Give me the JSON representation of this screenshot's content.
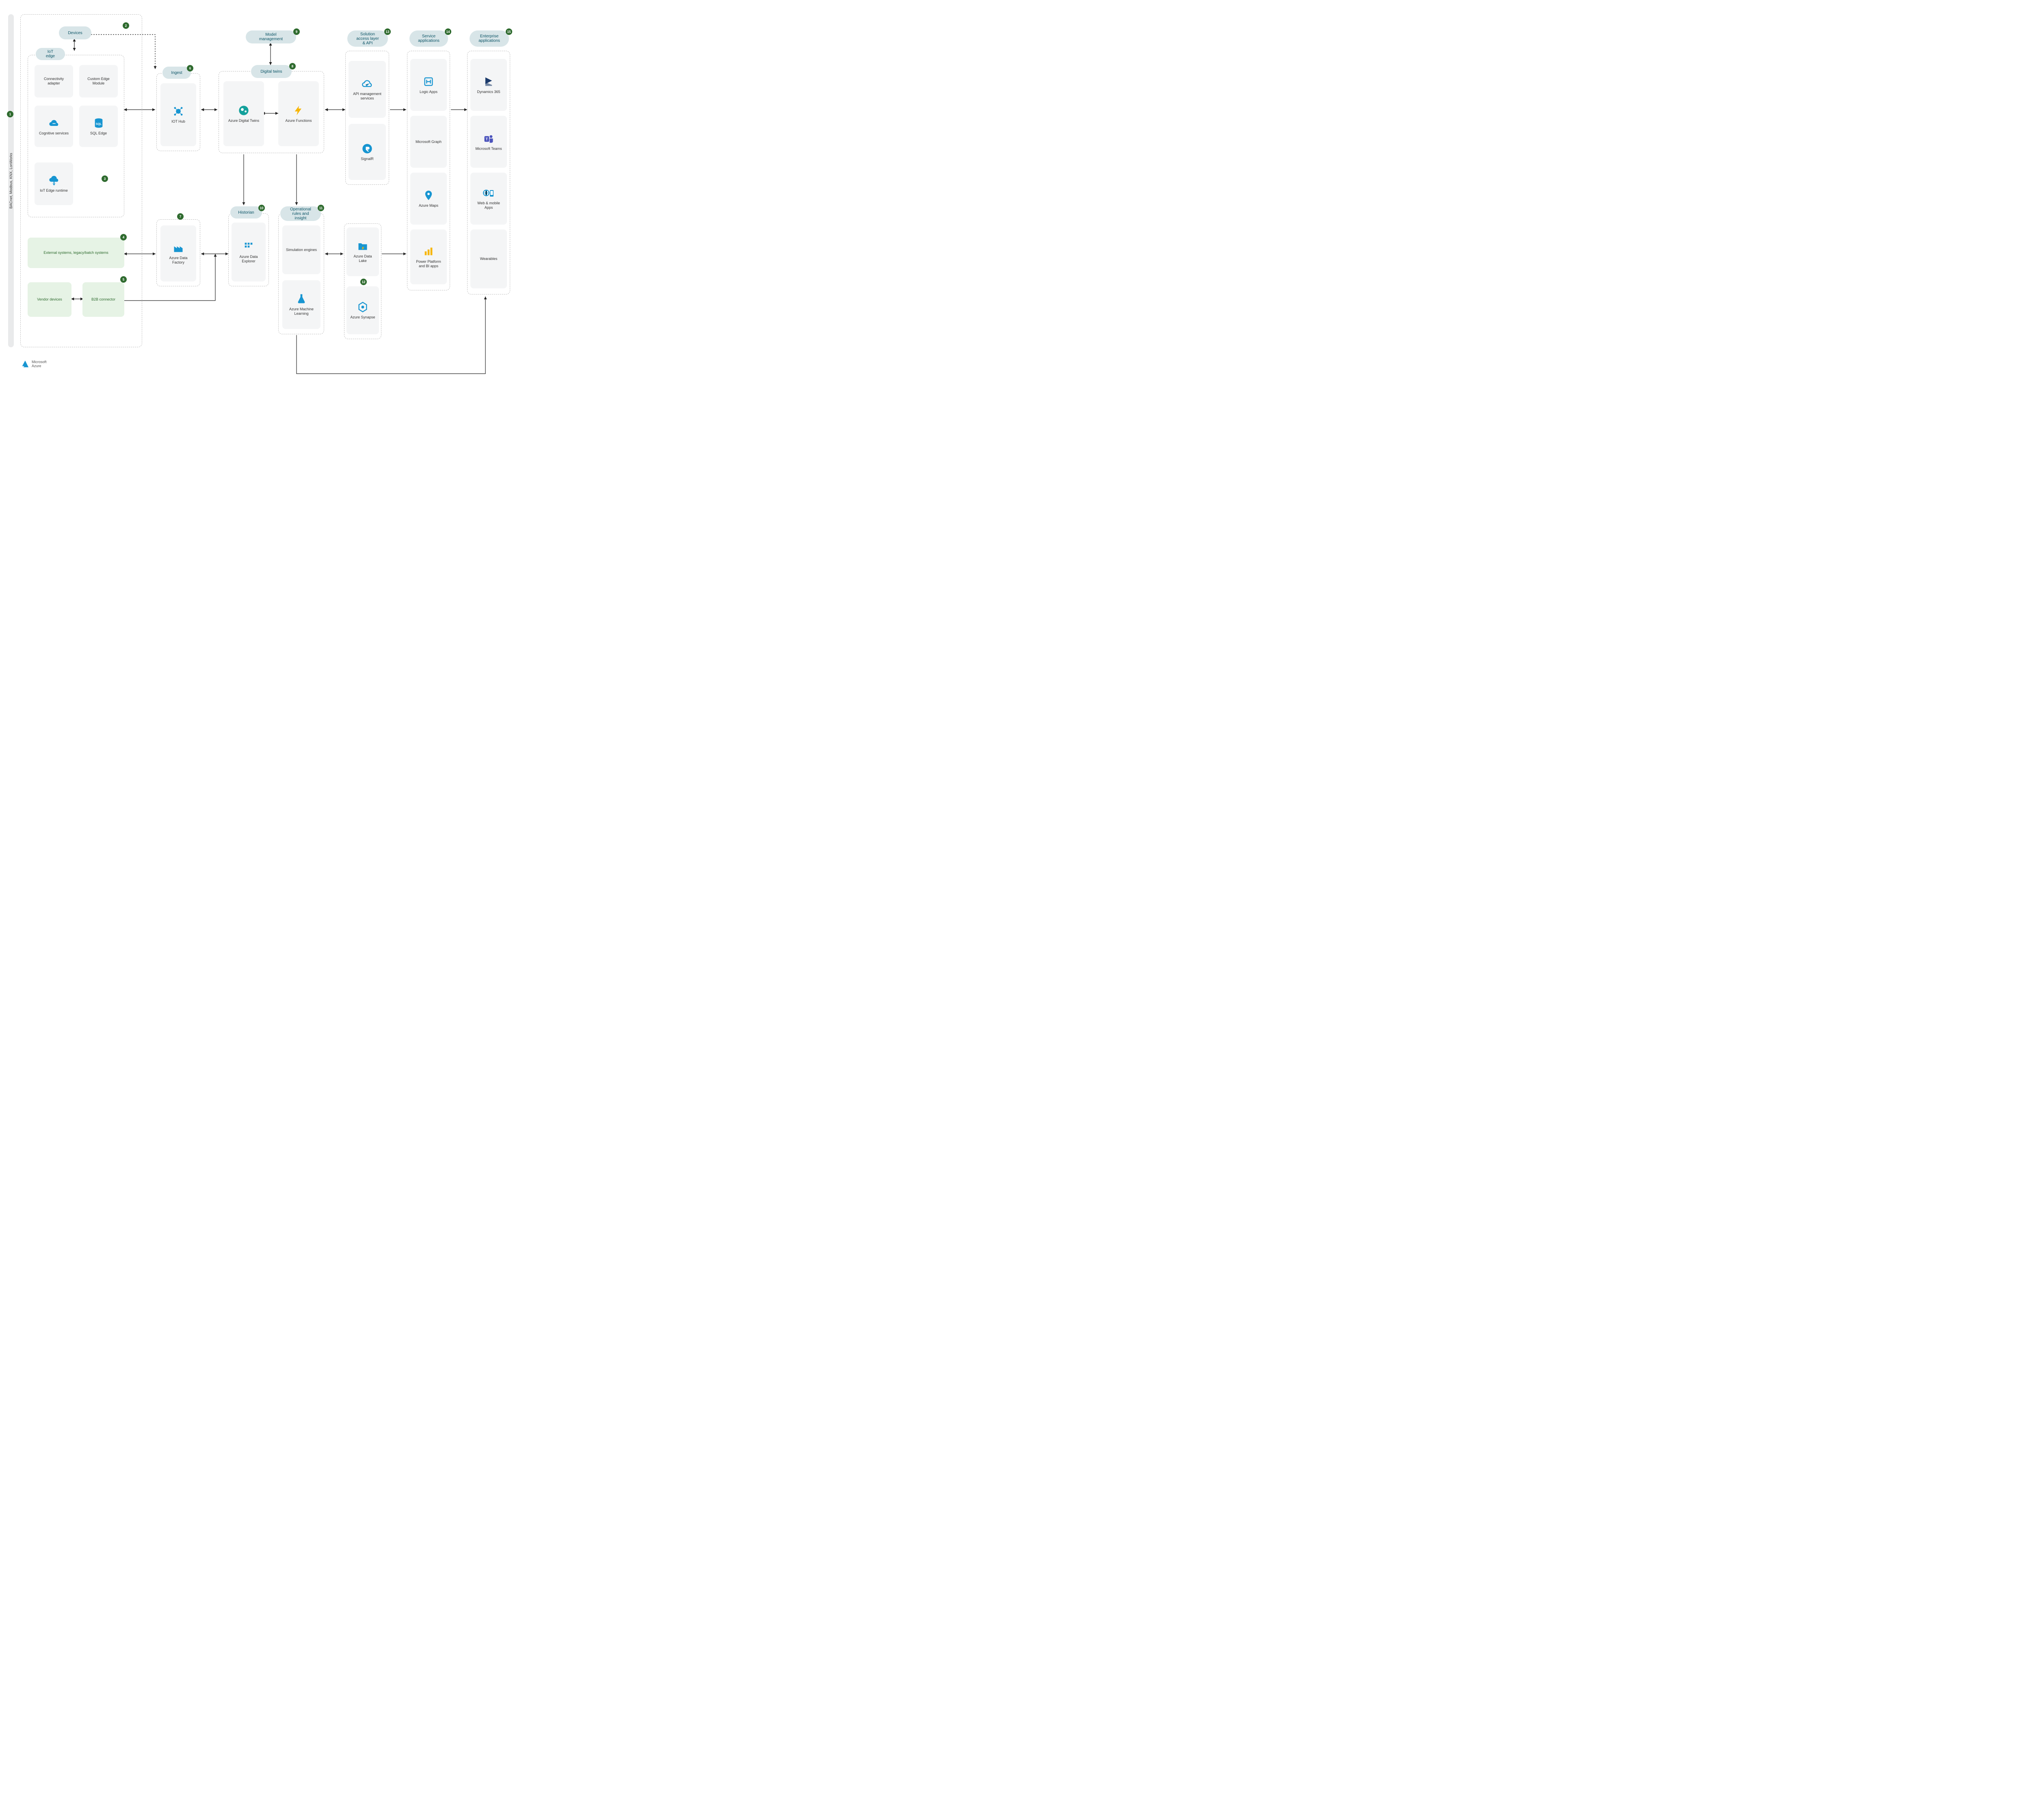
{
  "rail": {
    "label": "BACnet, Modbus, KNX, LonWorks"
  },
  "badges": [
    "1",
    "2",
    "3",
    "4",
    "5",
    "6",
    "7",
    "8",
    "9",
    "10",
    "11",
    "12",
    "13",
    "14",
    "15"
  ],
  "pills": {
    "devices": "Devices",
    "iotEdge": "IoT edge",
    "ingest": "Ingest",
    "digitalTwins": "Digital twins",
    "modelManagement": "Model management",
    "historian": "Historian",
    "operational": "Operational rules and insight",
    "access": "Solution access layer & API",
    "serviceApps": "Service applications",
    "enterprise": "Enterprise applications"
  },
  "cards": {
    "connectivity": "Connectivity adapter",
    "customEdge": "Custom Edge Module",
    "cognitive": "Cognitive services",
    "sqlEdge": "SQL Edge",
    "iotRuntime": "IoT Edge runtime",
    "external": "External systems, legacy/batch systems",
    "vendor": "Vendor devices",
    "b2b": "B2B connector",
    "iotHub": "IOT Hub",
    "dataFactory": "Azure Data Factory",
    "adt": "Azure Digital Twins",
    "functions": "Azure Functions",
    "dataExplorer": "Azure Data Explorer",
    "simEngines": "Simulation engines",
    "ml": "Azure Machine Learning",
    "apim": "API management services",
    "signalR": "SignalR",
    "dataLake": "Azure Data Lake",
    "synapse": "Azure Synapse",
    "logicApps": "Logic Apps",
    "graph": "Microsoft Graph",
    "maps": "Azure Maps",
    "powerPlat": "Power Platform and BI apps",
    "d365": "Dynamics 365",
    "teams": "Microsoft Teams",
    "webMobile": "Web & mobile Apps",
    "wearables": "Wearables"
  },
  "footer": {
    "brand1": "Microsoft",
    "brand2": "Azure"
  }
}
